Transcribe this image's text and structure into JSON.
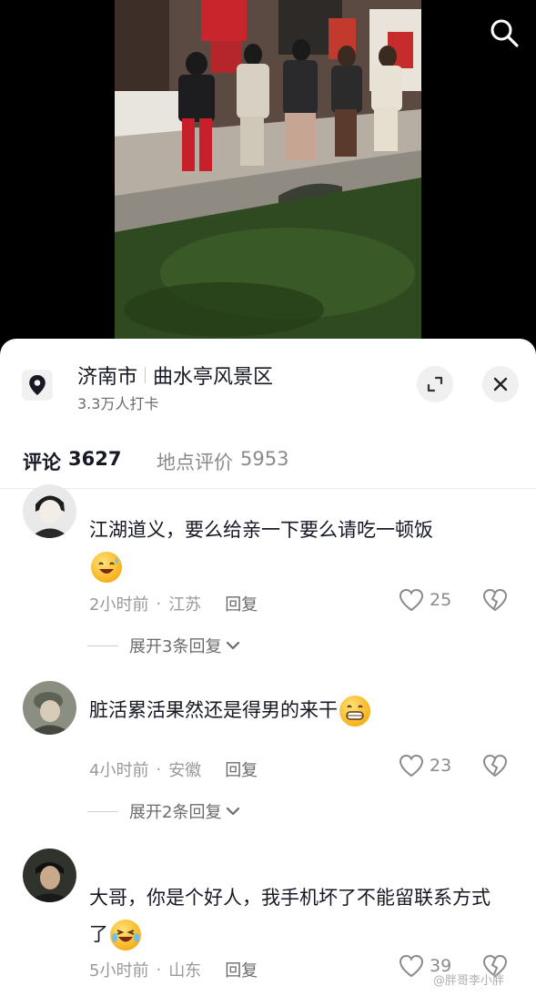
{
  "location": {
    "city": "济南市",
    "spot": "曲水亭风景区",
    "checkins": "3.3万人打卡",
    "pin_icon": "location-pin-icon",
    "expand_icon": "expand-icon",
    "close_icon": "close-icon"
  },
  "header": {
    "search_icon": "search-icon"
  },
  "tabs": [
    {
      "label": "评论",
      "count": "3627",
      "active": true
    },
    {
      "label": "地点评价",
      "count": "5953",
      "active": false
    }
  ],
  "comments": [
    {
      "text": "江湖道义，要么给亲一下要么请吃一顿饭",
      "emoji": "grinning-sweat-emoji",
      "time": "2小时前",
      "region": "江苏",
      "reply_label": "回复",
      "likes": "25",
      "expand_label": "展开3条回复"
    },
    {
      "text": "脏活累活果然还是得男的来干",
      "emoji": "grimacing-emoji",
      "time": "4小时前",
      "region": "安徽",
      "reply_label": "回复",
      "likes": "23",
      "expand_label": "展开2条回复"
    },
    {
      "text": "大哥，你是个好人，我手机坏了不能留联系方式了",
      "emoji": "crying-laughing-emoji",
      "time": "5小时前",
      "region": "山东",
      "reply_label": "回复",
      "likes": "39"
    }
  ],
  "watermark": "@胖哥李小胖",
  "colors": {
    "text_primary": "#161823",
    "text_secondary": "#999999",
    "sheet_bg": "#ffffff"
  }
}
